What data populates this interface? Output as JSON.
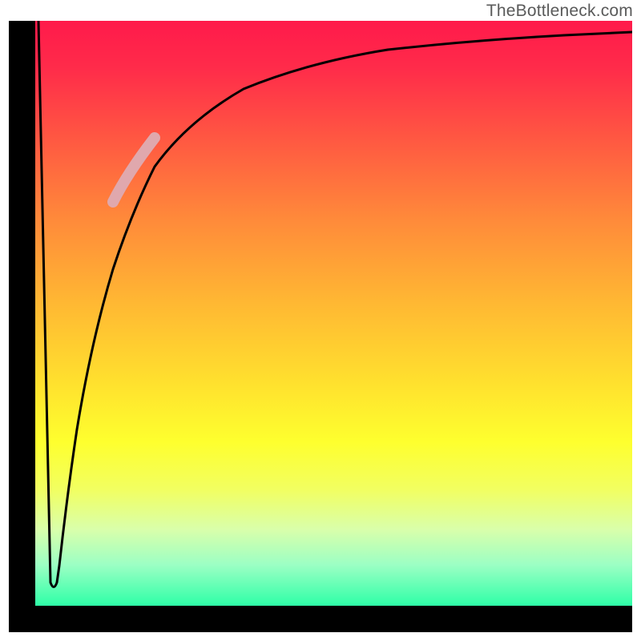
{
  "attribution": "TheBottleneck.com",
  "chart_data": {
    "type": "line",
    "title": "",
    "xlabel": "",
    "ylabel": "",
    "xlim": [
      0,
      100
    ],
    "ylim": [
      0,
      100
    ],
    "axes_visible": false,
    "background_gradient": {
      "direction": "vertical",
      "stops": [
        {
          "pos": 0.0,
          "color": "#ff1a4b"
        },
        {
          "pos": 0.2,
          "color": "#ff5742"
        },
        {
          "pos": 0.48,
          "color": "#ffb733"
        },
        {
          "pos": 0.72,
          "color": "#feff2e"
        },
        {
          "pos": 1.0,
          "color": "#2effa7"
        }
      ]
    },
    "series": [
      {
        "name": "bottleneck-curve",
        "color": "#000000",
        "stroke_width": 3,
        "points": [
          {
            "x": 0.5,
            "y": 100
          },
          {
            "x": 2.5,
            "y": 4
          },
          {
            "x": 3.5,
            "y": 4
          },
          {
            "x": 5.0,
            "y": 25
          },
          {
            "x": 7.0,
            "y": 45
          },
          {
            "x": 10.0,
            "y": 60
          },
          {
            "x": 14.0,
            "y": 71
          },
          {
            "x": 20.0,
            "y": 80
          },
          {
            "x": 28.0,
            "y": 86
          },
          {
            "x": 40.0,
            "y": 91
          },
          {
            "x": 55.0,
            "y": 94
          },
          {
            "x": 75.0,
            "y": 96
          },
          {
            "x": 100.0,
            "y": 97
          }
        ]
      },
      {
        "name": "highlight-segment",
        "color": "#e0a8ad",
        "stroke_width": 14,
        "points": [
          {
            "x": 13.0,
            "y": 69
          },
          {
            "x": 20.0,
            "y": 80
          }
        ]
      }
    ]
  }
}
